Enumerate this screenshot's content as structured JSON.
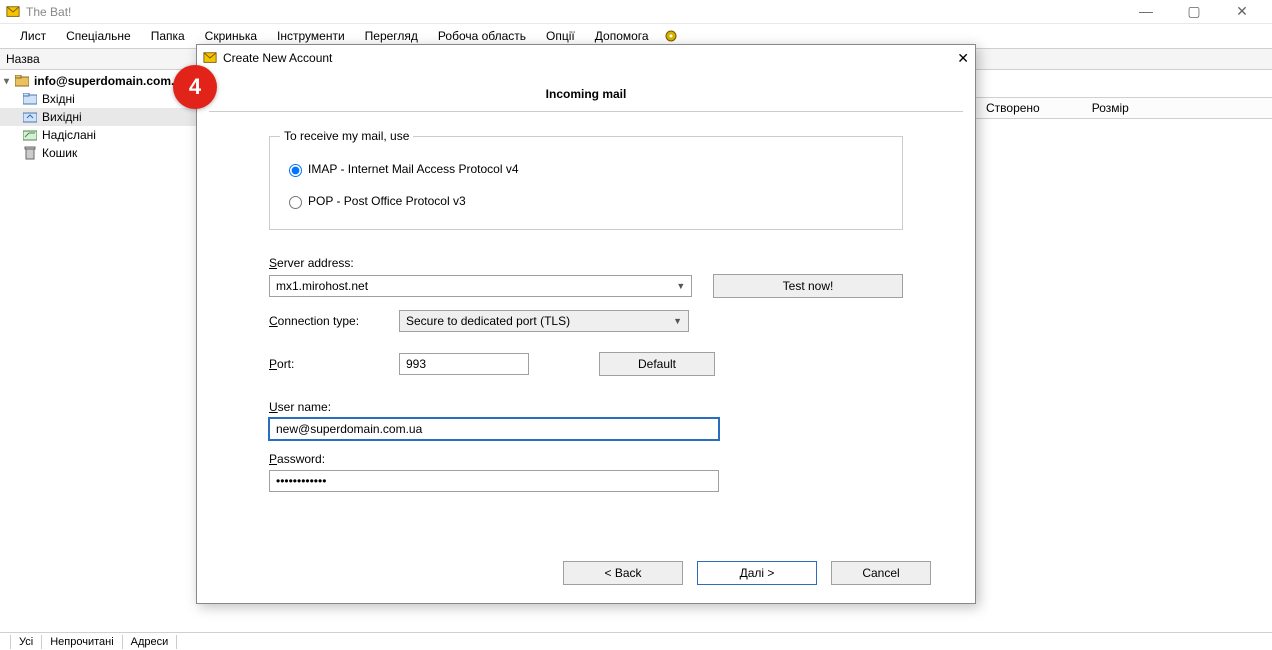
{
  "app_title": "The Bat!",
  "menus": [
    "Лист",
    "Спеціальне",
    "Папка",
    "Скринька",
    "Інструменти",
    "Перегляд",
    "Робоча область",
    "Опції",
    "Допомога"
  ],
  "tree_header": "Назва",
  "account_email": "info@superdomain.com.ua",
  "folders": [
    {
      "label": "Вхідні",
      "icon": "inbox"
    },
    {
      "label": "Вихідні",
      "icon": "outbox",
      "selected": true
    },
    {
      "label": "Надіслані",
      "icon": "sent"
    },
    {
      "label": "Кошик",
      "icon": "trash"
    }
  ],
  "right_columns": [
    "Створено",
    "Розмір"
  ],
  "bottom_tabs": [
    "Усі",
    "Непрочитані",
    "Адреси"
  ],
  "step_number": "4",
  "dialog": {
    "title": "Create New Account",
    "section": "Incoming mail",
    "fieldset_legend": "To receive my mail, use",
    "imap_label": "IMAP - Internet Mail Access Protocol v4",
    "pop_label": "POP  -  Post Office Protocol v3",
    "server_label_pre": "S",
    "server_label_rest": "erver address:",
    "server_value": "mx1.mirohost.net",
    "test_now": "Test now!",
    "conn_label_pre": "C",
    "conn_label_rest": "onnection type:",
    "conn_value": "Secure to dedicated port (TLS)",
    "port_label_pre": "P",
    "port_label_rest": "ort:",
    "port_value": "993",
    "default_btn": "Default",
    "user_label_pre": "U",
    "user_label_rest": "ser name:",
    "user_value": "new@superdomain.com.ua",
    "pass_label_pre": "P",
    "pass_label_rest": "assword:",
    "pass_value": "••••••••••••",
    "back_btn": "<  Back",
    "next_btn": "Далі  >",
    "cancel_btn": "Cancel"
  }
}
